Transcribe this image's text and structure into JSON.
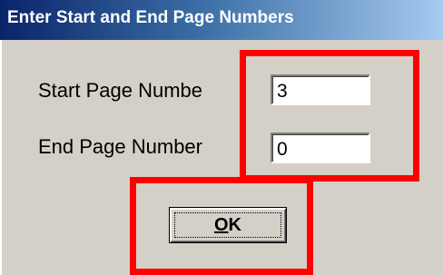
{
  "dialog": {
    "title": "Enter Start and End Page Numbers",
    "start_label": "Start Page Numbe",
    "end_label": "End Page Number",
    "start_value": "3",
    "end_value": "0",
    "ok_mnemonic": "O",
    "ok_rest": "K"
  },
  "colors": {
    "highlight": "#ff0000",
    "dialog_bg": "#d4d0c8",
    "title_start": "#0a246a",
    "title_end": "#a6caf0"
  }
}
